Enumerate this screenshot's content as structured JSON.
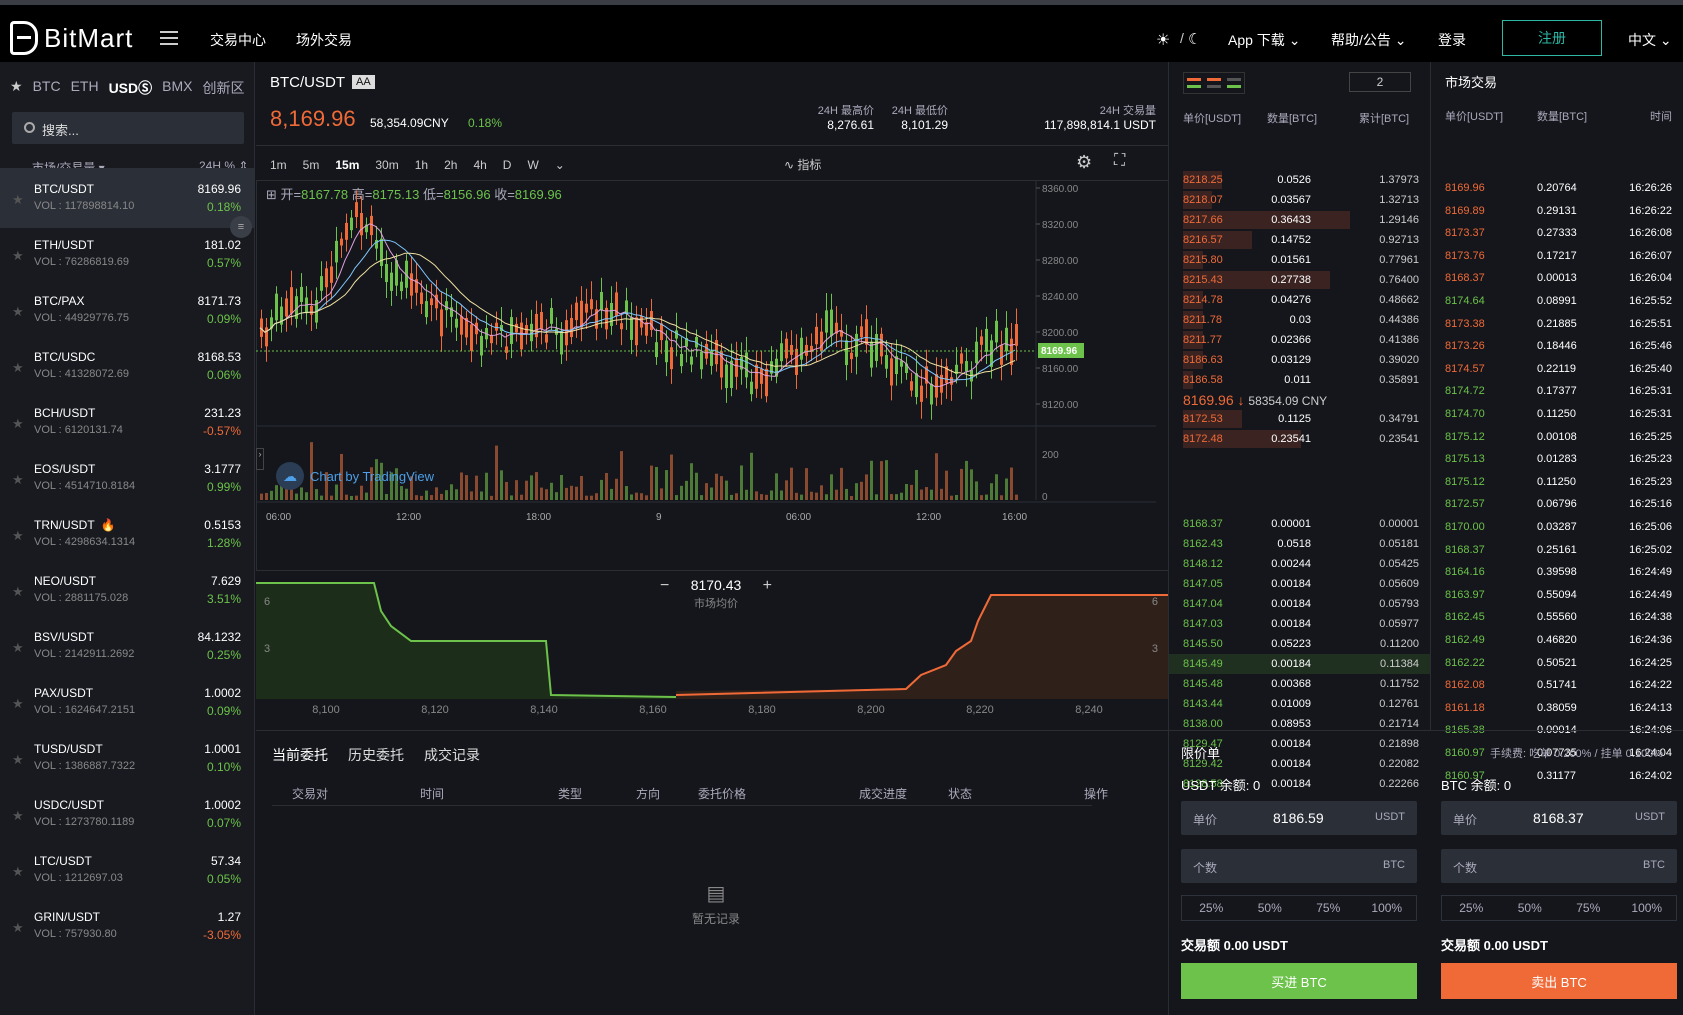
{
  "brand": {
    "name": "BitMart"
  },
  "topnav": {
    "trade_center": "交易中心",
    "otc": "场外交易",
    "app_download": "App 下载",
    "help": "帮助/公告",
    "login": "登录",
    "register": "注册",
    "language": "中文"
  },
  "markets": {
    "tabs": [
      "BTC",
      "ETH",
      "USDⓈ",
      "BMX",
      "创新区"
    ],
    "active": "USDⓈ",
    "search_placeholder": "搜索...",
    "col_market": "市场/交易量",
    "col_change": "24H %"
  },
  "pairs": [
    {
      "name": "BTC/USDT",
      "vol": "VOL : 117898814.10",
      "price": "8169.96",
      "change": "0.18%",
      "dir": "up",
      "selected": true
    },
    {
      "name": "ETH/USDT",
      "vol": "VOL : 76286819.69",
      "price": "181.02",
      "change": "0.57%",
      "dir": "up"
    },
    {
      "name": "BTC/PAX",
      "vol": "VOL : 44929776.75",
      "price": "8171.73",
      "change": "0.09%",
      "dir": "up"
    },
    {
      "name": "BTC/USDC",
      "vol": "VOL : 41328072.69",
      "price": "8168.53",
      "change": "0.06%",
      "dir": "up"
    },
    {
      "name": "BCH/USDT",
      "vol": "VOL : 6120131.74",
      "price": "231.23",
      "change": "-0.57%",
      "dir": "dn"
    },
    {
      "name": "EOS/USDT",
      "vol": "VOL : 4514710.8184",
      "price": "3.1777",
      "change": "0.99%",
      "dir": "up"
    },
    {
      "name": "TRN/USDT",
      "vol": "VOL : 4298634.1314",
      "price": "0.5153",
      "change": "1.28%",
      "dir": "up",
      "hot": true
    },
    {
      "name": "NEO/USDT",
      "vol": "VOL : 2881175.028",
      "price": "7.629",
      "change": "3.51%",
      "dir": "up"
    },
    {
      "name": "BSV/USDT",
      "vol": "VOL : 2142911.2692",
      "price": "84.1232",
      "change": "0.25%",
      "dir": "up"
    },
    {
      "name": "PAX/USDT",
      "vol": "VOL : 1624647.2151",
      "price": "1.0002",
      "change": "0.09%",
      "dir": "up"
    },
    {
      "name": "TUSD/USDT",
      "vol": "VOL : 1386887.7322",
      "price": "1.0001",
      "change": "0.10%",
      "dir": "up"
    },
    {
      "name": "USDC/USDT",
      "vol": "VOL : 1273780.1189",
      "price": "1.0002",
      "change": "0.07%",
      "dir": "up"
    },
    {
      "name": "LTC/USDT",
      "vol": "VOL : 1212697.03",
      "price": "57.34",
      "change": "0.05%",
      "dir": "up"
    },
    {
      "name": "GRIN/USDT",
      "vol": "VOL : 757930.80",
      "price": "1.27",
      "change": "-3.05%",
      "dir": "dn"
    }
  ],
  "ticker": {
    "pair": "BTC/USDT",
    "badge": "AA",
    "price": "8,169.96",
    "cny": "58,354.09CNY",
    "change": "0.18%",
    "high_label": "24H 最高价",
    "high": "8,276.61",
    "low_label": "24H 最低价",
    "low": "8,101.29",
    "vol_label": "24H 交易量",
    "vol": "117,898,814.1 USDT"
  },
  "chart": {
    "intervals": [
      "1m",
      "5m",
      "15m",
      "30m",
      "1h",
      "2h",
      "4h",
      "D",
      "W"
    ],
    "active_interval": "15m",
    "indicator_label": "指标",
    "ohlc": {
      "o_label": "开=",
      "o": "8167.78",
      "h_label": "高=",
      "h": "8175.13",
      "l_label": "低=",
      "l": "8156.96",
      "c_label": "收=",
      "c": "8169.96"
    },
    "watermark": "Chart by TradingView",
    "y_ticks": [
      "8360.00",
      "8320.00",
      "8280.00",
      "8240.00",
      "8200.00",
      "8160.00",
      "8120.00"
    ],
    "vol_ticks": [
      "200",
      "0"
    ],
    "x_ticks": [
      "06:00",
      "12:00",
      "18:00",
      "9",
      "06:00",
      "12:00",
      "16:00"
    ],
    "last_price_tag": "8169.96"
  },
  "depth": {
    "mid_price": "8170.43",
    "mid_label": "市场均价",
    "x_ticks": [
      "8,100",
      "8,120",
      "8,140",
      "8,160",
      "8,180",
      "8,200",
      "8,220",
      "8,240"
    ],
    "y_left": [
      "6",
      "3"
    ],
    "y_right": [
      "6",
      "3"
    ]
  },
  "orders": {
    "tabs": [
      "当前委托",
      "历史委托",
      "成交记录"
    ],
    "columns": [
      "交易对",
      "时间",
      "类型",
      "方向",
      "委托价格",
      "成交进度",
      "状态",
      "操作"
    ],
    "empty": "暂无记录"
  },
  "book": {
    "depth_select": "2",
    "cols": [
      "单价[USDT]",
      "数量[BTC]",
      "累计[BTC]"
    ],
    "asks": [
      [
        "8218.25",
        "0.0526",
        "1.37973"
      ],
      [
        "8218.07",
        "0.03567",
        "1.32713"
      ],
      [
        "8217.66",
        "0.36433",
        "1.29146"
      ],
      [
        "8216.57",
        "0.14752",
        "0.92713"
      ],
      [
        "8215.80",
        "0.01561",
        "0.77961"
      ],
      [
        "8215.43",
        "0.27738",
        "0.76400"
      ],
      [
        "8214.78",
        "0.04276",
        "0.48662"
      ],
      [
        "8211.78",
        "0.03",
        "0.44386"
      ],
      [
        "8211.77",
        "0.02366",
        "0.41386"
      ],
      [
        "8186.63",
        "0.03129",
        "0.39020"
      ],
      [
        "8186.58",
        "0.011",
        "0.35891"
      ],
      [
        "8172.53",
        "0.1125",
        "0.34791"
      ],
      [
        "8172.48",
        "0.23541",
        "0.23541"
      ]
    ],
    "ask_depth": [
      0.2,
      0.15,
      0.85,
      0.35,
      0.1,
      0.75,
      0.1,
      0.1,
      0.1,
      0.1,
      0.05,
      0.3,
      0.6
    ],
    "last_price": "8169.96",
    "last_cny": "58354.09 CNY",
    "bids": [
      [
        "8168.37",
        "0.00001",
        "0.00001"
      ],
      [
        "8162.43",
        "0.0518",
        "0.05181"
      ],
      [
        "8148.12",
        "0.00244",
        "0.05425"
      ],
      [
        "8147.05",
        "0.00184",
        "0.05609"
      ],
      [
        "8147.04",
        "0.00184",
        "0.05793"
      ],
      [
        "8147.03",
        "0.00184",
        "0.05977"
      ],
      [
        "8145.50",
        "0.05223",
        "0.11200"
      ],
      [
        "8145.49",
        "0.00184",
        "0.11384"
      ],
      [
        "8145.48",
        "0.00368",
        "0.11752"
      ],
      [
        "8143.44",
        "0.01009",
        "0.12761"
      ],
      [
        "8138.00",
        "0.08953",
        "0.21714"
      ],
      [
        "8129.47",
        "0.00184",
        "0.21898"
      ],
      [
        "8129.42",
        "0.00184",
        "0.22082"
      ],
      [
        "8128.58",
        "0.00184",
        "0.22266"
      ]
    ]
  },
  "trades": {
    "title": "市场交易",
    "cols": [
      "单价[USDT]",
      "数量[BTC]",
      "时间"
    ],
    "rows": [
      [
        "8169.96",
        "0.20764",
        "16:26:26",
        "dn"
      ],
      [
        "8169.89",
        "0.29131",
        "16:26:22",
        "dn"
      ],
      [
        "8173.37",
        "0.27333",
        "16:26:08",
        "dn"
      ],
      [
        "8173.76",
        "0.17217",
        "16:26:07",
        "dn"
      ],
      [
        "8168.37",
        "0.00013",
        "16:26:04",
        "dn"
      ],
      [
        "8174.64",
        "0.08991",
        "16:25:52",
        "up"
      ],
      [
        "8173.38",
        "0.21885",
        "16:25:51",
        "dn"
      ],
      [
        "8173.26",
        "0.18446",
        "16:25:46",
        "dn"
      ],
      [
        "8174.57",
        "0.22119",
        "16:25:40",
        "dn"
      ],
      [
        "8174.72",
        "0.17377",
        "16:25:31",
        "up"
      ],
      [
        "8174.70",
        "0.11250",
        "16:25:31",
        "up"
      ],
      [
        "8175.12",
        "0.00108",
        "16:25:25",
        "up"
      ],
      [
        "8175.13",
        "0.01283",
        "16:25:23",
        "up"
      ],
      [
        "8175.12",
        "0.11250",
        "16:25:23",
        "up"
      ],
      [
        "8172.57",
        "0.06796",
        "16:25:16",
        "up"
      ],
      [
        "8170.00",
        "0.03287",
        "16:25:06",
        "up"
      ],
      [
        "8168.37",
        "0.25161",
        "16:25:02",
        "up"
      ],
      [
        "8164.16",
        "0.39598",
        "16:24:49",
        "up"
      ],
      [
        "8163.97",
        "0.55094",
        "16:24:49",
        "up"
      ],
      [
        "8162.45",
        "0.55560",
        "16:24:38",
        "up"
      ],
      [
        "8162.49",
        "0.46820",
        "16:24:36",
        "up"
      ],
      [
        "8162.22",
        "0.50521",
        "16:24:25",
        "up"
      ],
      [
        "8162.08",
        "0.51741",
        "16:24:22",
        "dn"
      ],
      [
        "8161.18",
        "0.38059",
        "16:24:13",
        "dn"
      ],
      [
        "8165.38",
        "0.00014",
        "16:24:06",
        "up"
      ],
      [
        "8160.97",
        "0.07735",
        "16:24:04",
        "up"
      ],
      [
        "8160.97",
        "0.31177",
        "16:24:02",
        "up"
      ]
    ]
  },
  "form": {
    "title": "限价单",
    "fee": "手续费: 吃单 0.200% / 挂单 0.100%",
    "buy": {
      "balance": "USDT 余额: 0",
      "price_label": "单价",
      "price": "8186.59",
      "price_unit": "USDT",
      "qty_label": "个数",
      "qty_unit": "BTC",
      "amount": "交易额 0.00 USDT",
      "button": "买进 BTC"
    },
    "sell": {
      "balance": "BTC 余额: 0",
      "price_label": "单价",
      "price": "8168.37",
      "price_unit": "USDT",
      "qty_label": "个数",
      "qty_unit": "BTC",
      "amount": "交易额 0.00 USDT",
      "button": "卖出 BTC"
    },
    "pcts": [
      "25%",
      "50%",
      "75%",
      "100%"
    ]
  },
  "colors": {
    "up": "#6cc24a",
    "down": "#f06a38",
    "accent": "#2bb8a5"
  }
}
